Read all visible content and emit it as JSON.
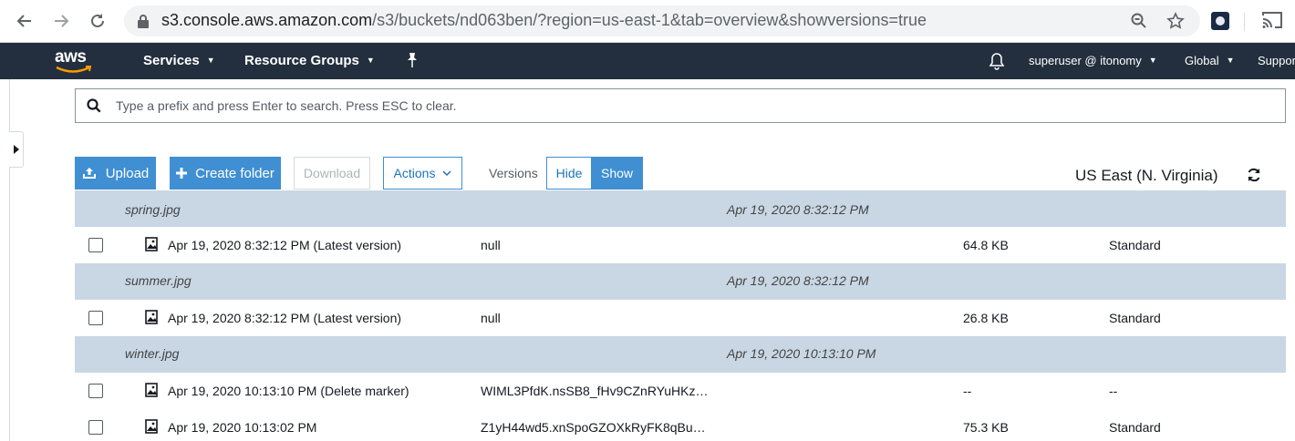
{
  "browser": {
    "url_host": "s3.console.aws.amazon.com",
    "url_path": "/s3/buckets/nd063ben/?region=us-east-1&tab=overview&showversions=true"
  },
  "awsnav": {
    "logo": "aws",
    "services": "Services",
    "resource_groups": "Resource Groups",
    "user": "superuser @ itonomy",
    "region": "Global",
    "support": "Support"
  },
  "search": {
    "placeholder": "Type a prefix and press Enter to search. Press ESC to clear."
  },
  "toolbar": {
    "upload": "Upload",
    "create_folder": "Create folder",
    "download": "Download",
    "actions": "Actions",
    "versions_label": "Versions",
    "hide": "Hide",
    "show": "Show",
    "region": "US East (N. Virginia)"
  },
  "table": {
    "rows": [
      {
        "type": "group",
        "name": "spring.jpg",
        "date": "Apr 19, 2020 8:32:12 PM"
      },
      {
        "type": "item",
        "label": "Apr 19, 2020 8:32:12 PM (Latest version)",
        "version_id": "null",
        "size": "64.8 KB",
        "storage_class": "Standard"
      },
      {
        "type": "group",
        "name": "summer.jpg",
        "date": "Apr 19, 2020 8:32:12 PM"
      },
      {
        "type": "item",
        "label": "Apr 19, 2020 8:32:12 PM (Latest version)",
        "version_id": "null",
        "size": "26.8 KB",
        "storage_class": "Standard"
      },
      {
        "type": "group",
        "name": "winter.jpg",
        "date": "Apr 19, 2020 10:13:10 PM"
      },
      {
        "type": "item",
        "label": "Apr 19, 2020 10:13:10 PM (Delete marker)",
        "version_id": "WIML3PfdK.nsSB8_fHv9CZnRYuHKz…",
        "size": "--",
        "storage_class": "--"
      },
      {
        "type": "item",
        "label": "Apr 19, 2020 10:13:02 PM",
        "version_id": "Z1yH44wd5.xnSpoGZOXkRyFK8qBu…",
        "size": "75.3 KB",
        "storage_class": "Standard"
      }
    ]
  },
  "colors": {
    "aws_nav_bg": "#232f3e",
    "primary_blue": "#3f8fd2",
    "group_row_bg": "#c9d7e4"
  }
}
